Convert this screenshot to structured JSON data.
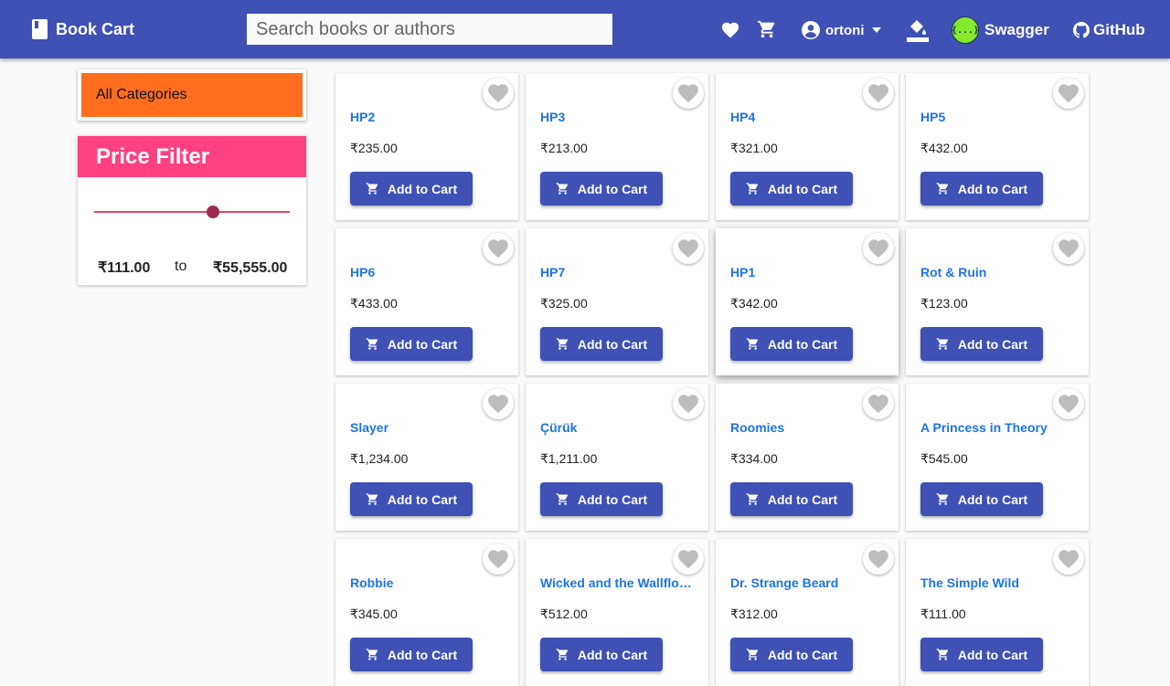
{
  "toolbar": {
    "brand": "Book Cart",
    "search_placeholder": "Search books or authors",
    "user_name": "ortoni",
    "swagger_label": "Swagger",
    "swagger_logo": "{...}",
    "github_label": "GitHub",
    "color": "#3f51b5"
  },
  "sidebar": {
    "category": "All Categories",
    "category_color": "#ff6d1f",
    "price_filter_title": "Price Filter",
    "price_filter_color": "#ff4081",
    "price_min": "₹111.00",
    "price_to": "to",
    "price_max": "₹55,555.00"
  },
  "add_to_cart_label": "Add to Cart",
  "books": [
    {
      "title": "HP2",
      "price": "₹235.00"
    },
    {
      "title": "HP3",
      "price": "₹213.00"
    },
    {
      "title": "HP4",
      "price": "₹321.00"
    },
    {
      "title": "HP5",
      "price": "₹432.00"
    },
    {
      "title": "HP6",
      "price": "₹433.00"
    },
    {
      "title": "HP7",
      "price": "₹325.00"
    },
    {
      "title": "HP1",
      "price": "₹342.00"
    },
    {
      "title": "Rot & Ruin",
      "price": "₹123.00"
    },
    {
      "title": "Slayer",
      "price": "₹1,234.00"
    },
    {
      "title": "Çürük",
      "price": "₹1,211.00"
    },
    {
      "title": "Roomies",
      "price": "₹334.00"
    },
    {
      "title": "A Princess in Theory",
      "price": "₹545.00"
    },
    {
      "title": "Robbie",
      "price": "₹345.00"
    },
    {
      "title": "Wicked and the Wallflower",
      "price": "₹512.00"
    },
    {
      "title": "Dr. Strange Beard",
      "price": "₹312.00"
    },
    {
      "title": "The Simple Wild",
      "price": "₹111.00"
    }
  ]
}
